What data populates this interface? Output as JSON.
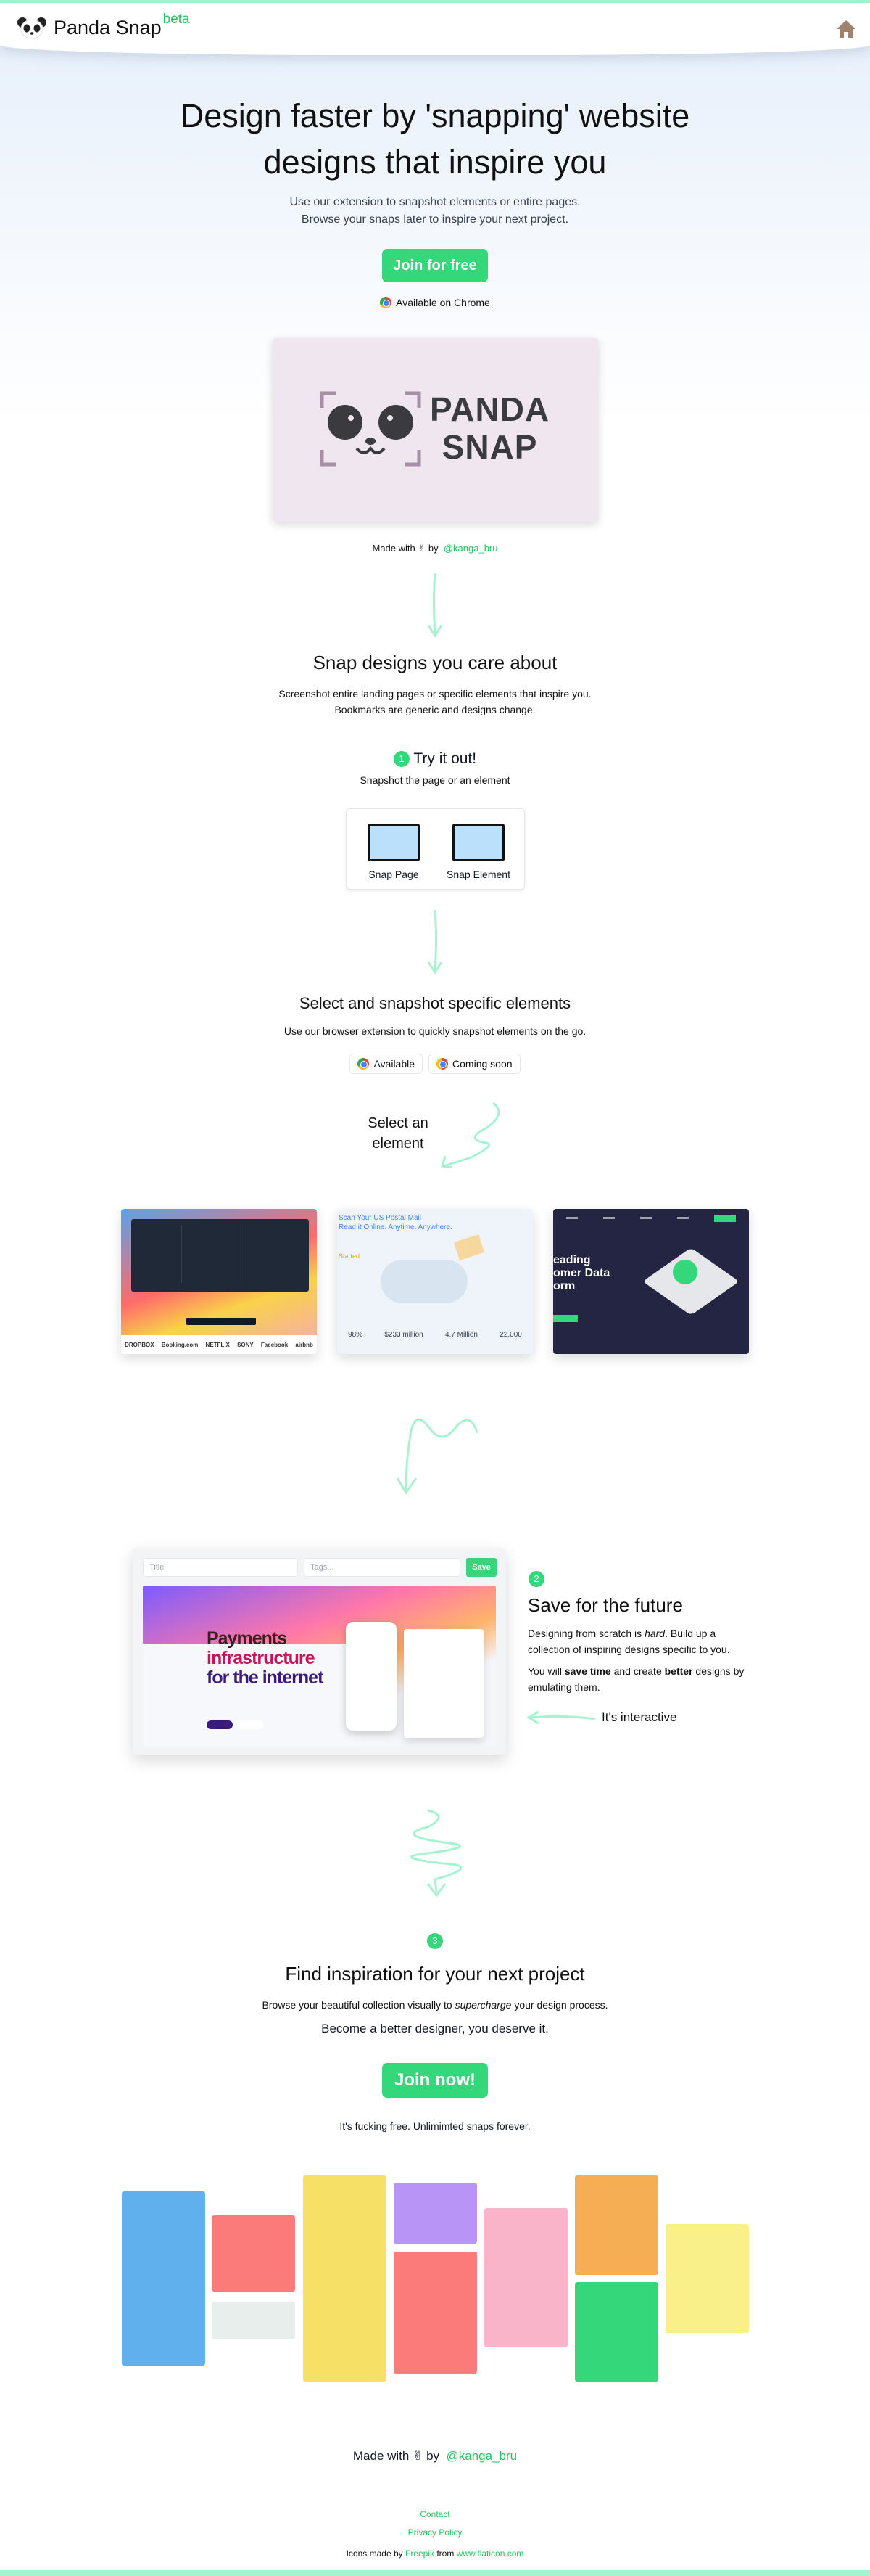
{
  "header": {
    "brand": "Panda Snap",
    "beta": "beta"
  },
  "hero": {
    "title_line1": "Design faster by 'snapping' website",
    "title_line2": "designs that inspire you",
    "sub_line1": "Use our extension to snapshot elements or entire pages.",
    "sub_line2": "Browse your snaps later to inspire your next project.",
    "cta": "Join for free",
    "chrome_text": "Available on Chrome"
  },
  "logo_card": {
    "line1": "PANDA",
    "line2": "SNAP"
  },
  "made_with": {
    "prefix": "Made with",
    "by": "by",
    "handle": "@kanga_bru"
  },
  "section1": {
    "title": "Snap designs you care about",
    "sub_line1": "Screenshot entire landing pages or specific elements that inspire you.",
    "sub_line2": "Bookmarks are generic and designs change."
  },
  "try_it": {
    "number": "1",
    "title": "Try it out!",
    "sub": "Snapshot the page or an element",
    "snap_page": "Snap Page",
    "snap_element": "Snap Element"
  },
  "section2": {
    "title": "Select and snapshot specific elements",
    "sub": "Use our browser extension to quickly snapshot elements on the go.",
    "pill_available": "Available",
    "pill_coming": "Coming soon",
    "hand_label_line1": "Select an",
    "hand_label_line2": "element"
  },
  "screenshots": {
    "shot2_line1": "Scan Your US Postal Mail",
    "shot2_line2": "Read it Online. Anytime. Anywhere.",
    "shot2_started": "Started",
    "shot2_stats": [
      "98%",
      "$233 million",
      "4.7 Million",
      "22,000"
    ],
    "shot3_line1": "eading",
    "shot3_line2": "omer Data",
    "shot3_line3": "orm",
    "shot1_logos": [
      "DROPBOX",
      "Booking.com",
      "NETFLIX",
      "SONY",
      "Facebook",
      "airbnb"
    ]
  },
  "save_section": {
    "number": "2",
    "title": "Save for the future",
    "p1_a": "Designing from scratch is ",
    "p1_em": "hard",
    "p1_b": ". Build up a collection of inspiring designs specific to you.",
    "p2_a": "You will ",
    "p2_b1": "save time",
    "p2_c": " and create ",
    "p2_b2": "better",
    "p2_d": " designs by emulating them.",
    "interactive_label": "It's interactive",
    "title_placeholder": "Title",
    "tags_placeholder": "Tags...",
    "save_label": "Save",
    "stripe_line1": "Payments",
    "stripe_line2": "infrastructure",
    "stripe_line3": "for the internet"
  },
  "inspiration": {
    "number": "3",
    "title": "Find inspiration for your next project",
    "sub_a": "Browse your beautiful collection visually to ",
    "sub_em": "supercharge",
    "sub_b": " your design process.",
    "tagline": "Become a better designer, you deserve it.",
    "cta": "Join now!",
    "note": "It's fucking free. Unlimimted snaps forever."
  },
  "gallery_colors": [
    "#60b0ee",
    "#fb7b7b",
    "#e8eeec",
    "#f6e066",
    "#b794f6",
    "#fb7b7b",
    "#f9b4c9",
    "#f6ae55",
    "#34d77a",
    "#faf08a"
  ],
  "footer": {
    "made_prefix": "Made with",
    "by": "by",
    "handle": "@kanga_bru",
    "contact": "Contact",
    "privacy": "Privacy Policy",
    "icons_a": "Icons made by",
    "icons_freepik": "Freepik",
    "icons_from": "from",
    "icons_flaticon": "www.flaticon.com"
  },
  "colors": {
    "accent": "#34d77a",
    "mint_arrow": "#a7f3d0"
  }
}
